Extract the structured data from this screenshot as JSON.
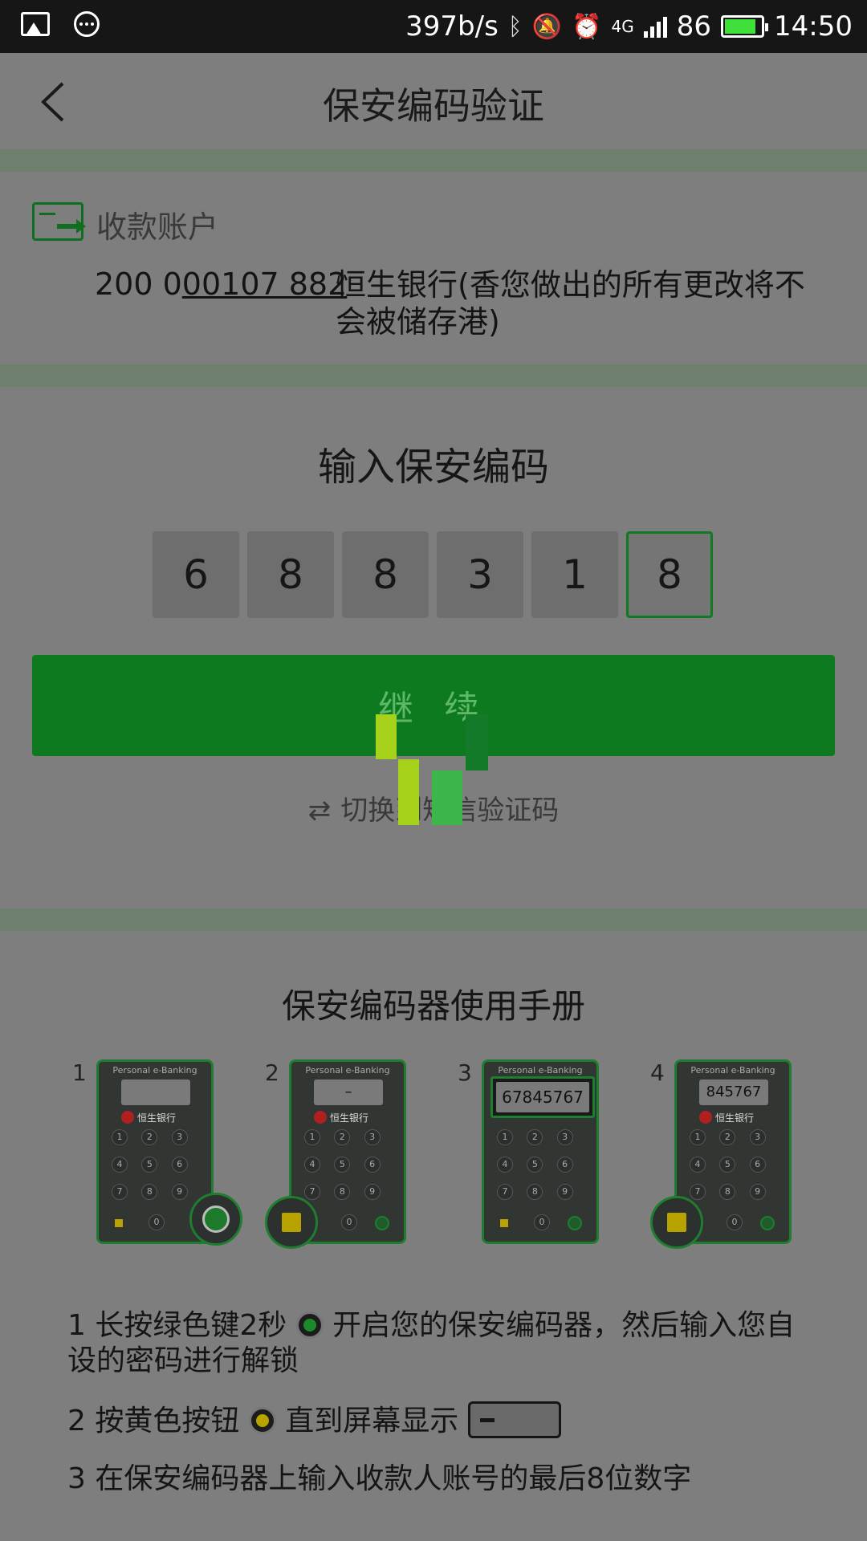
{
  "status_bar": {
    "speed": "397b/s",
    "network": "4G",
    "battery": "86",
    "time": "14:50"
  },
  "header": {
    "title": "保安编码验证"
  },
  "account": {
    "label": "收款账户",
    "number_prefix": "200 0",
    "number_rest": "00107 882",
    "bank": "恒生银行(香您做出的所有更改将不会被储存港)"
  },
  "code": {
    "title": "输入保安编码",
    "digits": [
      "6",
      "8",
      "8",
      "3",
      "1",
      "8"
    ],
    "continue_label": "继 续",
    "switch_label": "切换到短信验证码"
  },
  "manual": {
    "title": "保安编码器使用手册",
    "devices": [
      {
        "num": "1",
        "head": "Personal e-Banking",
        "screen": ""
      },
      {
        "num": "2",
        "head": "Personal e-Banking",
        "screen": "–"
      },
      {
        "num": "3",
        "head": "Personal e-Banking",
        "screen": "67845767"
      },
      {
        "num": "4",
        "head": "Personal e-Banking",
        "screen": "845767"
      }
    ],
    "bank_logo_text": "恒生银行",
    "keys": [
      "1",
      "2",
      "3",
      "4",
      "5",
      "6",
      "7",
      "8",
      "9"
    ],
    "zero_key": "0",
    "step1_a": "1 长按绿色键2秒",
    "step1_b": "开启您的保安编码器，然后输入您自设的密码进行解锁",
    "step2_a": "2 按黄色按钮",
    "step2_b": "直到屏幕显示",
    "step3": "3 在保安编码器上输入收款人账号的最后8位数字"
  },
  "colors": {
    "accent_green": "#0d7a20",
    "overlay_bg": "#7e7e7e",
    "status_bar_bg": "#161616"
  }
}
